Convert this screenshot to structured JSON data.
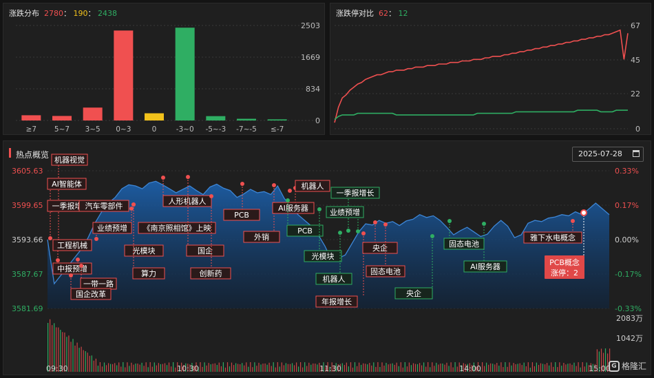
{
  "dist_panel": {
    "title": "涨跌分布",
    "up": "2780",
    "sep1": "：",
    "flat": "190",
    "sep2": "：",
    "down": "2438"
  },
  "limit_panel": {
    "title": "涨跌停对比",
    "up": "62",
    "sep": "：",
    "down": "12"
  },
  "hot_panel": {
    "title": "热点概览",
    "date": "2025-07-28"
  },
  "logo": {
    "icon": "G",
    "text": "格隆汇"
  },
  "colors": {
    "red": "#f05050",
    "green": "#2fae63",
    "yellow": "#f2c21b",
    "blue": "#1d5fa8"
  },
  "chart_data": [
    {
      "type": "bar",
      "categories": [
        "≥7",
        "5~7",
        "3~5",
        "0~3",
        "0",
        "-3~0",
        "-5~-3",
        "-7~-5",
        "≤-7"
      ],
      "values": [
        138,
        120,
        340,
        2370,
        190,
        2445,
        115,
        45,
        30
      ],
      "yticks": [
        "2503",
        "1669",
        "834",
        "0"
      ],
      "ylim": [
        0,
        2503
      ],
      "colors": [
        "#f05050",
        "#f05050",
        "#f05050",
        "#f05050",
        "#f2c21b",
        "#2fae63",
        "#2fae63",
        "#2fae63",
        "#2fae63"
      ]
    },
    {
      "type": "line",
      "yticks": [
        "67",
        "45",
        "22",
        "0"
      ],
      "ylim": [
        0,
        67
      ],
      "series": [
        {
          "color": "#f05050",
          "values": [
            4,
            14,
            20,
            22,
            25,
            27,
            29,
            30,
            32,
            33,
            34,
            35,
            35,
            36,
            37,
            37,
            38,
            38,
            38,
            39,
            39,
            40,
            40,
            40,
            41,
            41,
            41,
            42,
            42,
            42,
            43,
            43,
            43,
            44,
            44,
            44,
            45,
            45,
            45,
            46,
            46,
            47,
            47,
            47,
            48,
            48,
            49,
            49,
            50,
            50,
            51,
            51,
            52,
            52,
            53,
            53,
            54,
            54,
            55,
            55,
            56,
            56,
            57,
            57,
            58,
            58,
            59,
            59,
            60,
            60,
            61,
            61,
            62,
            63,
            64,
            45,
            62
          ]
        },
        {
          "color": "#2fae63",
          "values": [
            6,
            8,
            9,
            9,
            9,
            9,
            10,
            10,
            10,
            10,
            10,
            10,
            10,
            10,
            10,
            10,
            9,
            9,
            9,
            9,
            9,
            9,
            9,
            9,
            9,
            9,
            9,
            9,
            9,
            9,
            9,
            9,
            9,
            9,
            9,
            9,
            9,
            10,
            10,
            10,
            10,
            10,
            10,
            10,
            10,
            10,
            10,
            11,
            11,
            11,
            11,
            11,
            11,
            11,
            11,
            11,
            11,
            11,
            11,
            11,
            11,
            11,
            11,
            12,
            12,
            12,
            12,
            12,
            12,
            11,
            11,
            11,
            11,
            12,
            12,
            12,
            12
          ]
        }
      ]
    },
    {
      "type": "area",
      "y_left_ticks": [
        "3605.63",
        "3599.65",
        "3593.66",
        "3587.67",
        "3581.69"
      ],
      "y_right_ticks": [
        "0.33%",
        "0.17%",
        "0.00%",
        "-0.17%",
        "-0.33%"
      ],
      "ylim": [
        3581.69,
        3605.63
      ],
      "vol_ticks": [
        "2083万",
        "1042万"
      ],
      "x_ticks": [
        "09:30",
        "10:30",
        "11:30",
        "14:00",
        "15:00"
      ],
      "price": [
        3593.66,
        3586.0,
        3587.5,
        3589.0,
        3590.5,
        3592.0,
        3594.0,
        3596.5,
        3598.5,
        3600.0,
        3601.0,
        3602.5,
        3603.2,
        3603.0,
        3602.5,
        3603.5,
        3603.8,
        3603.2,
        3602.5,
        3601.8,
        3602.4,
        3603.0,
        3602.2,
        3601.5,
        3602.8,
        3603.3,
        3602.6,
        3602.2,
        3601.0,
        3601.6,
        3602.4,
        3601.8,
        3602.0,
        3601.5,
        3603.0,
        3600.8,
        3599.5,
        3598.0,
        3597.0,
        3596.0,
        3594.5,
        3592.5,
        3590.0,
        3590.4,
        3591.0,
        3593.0,
        3595.0,
        3596.4,
        3596.2,
        3597.0,
        3596.5,
        3596.8,
        3596.1,
        3596.9,
        3597.2,
        3598.0,
        3597.5,
        3597.8,
        3597.0,
        3595.8,
        3594.5,
        3595.2,
        3595.8,
        3595.0,
        3594.2,
        3594.6,
        3596.0,
        3597.0,
        3596.0,
        3594.0,
        3594.5,
        3596.5,
        3597.0,
        3596.8,
        3597.4,
        3597.6,
        3598.0,
        3597.8,
        3598.5,
        3598.0,
        3599.0,
        3600.0,
        3599.0,
        3598.0
      ],
      "annotations": [
        {
          "label": "机器视觉",
          "color": "red",
          "at": 0.2
        },
        {
          "label": "AI智能体",
          "color": "red",
          "at": 0.2
        },
        {
          "label": "一季报增长",
          "color": "red",
          "at": 0.2
        },
        {
          "label": "汽车零部件",
          "color": "red",
          "at": 0.5
        },
        {
          "label": "业绩预增",
          "color": "red",
          "at": 1.0
        },
        {
          "label": "工程机械",
          "color": "red",
          "at": 1.0
        },
        {
          "label": "中报预增",
          "color": "red",
          "at": 2.0
        },
        {
          "label": "一带一路",
          "color": "red",
          "at": 2.0
        },
        {
          "label": "国企改革",
          "color": "red",
          "at": 2.0
        },
        {
          "label": "《南京照相馆》上映",
          "color": "red",
          "at": 3.0
        },
        {
          "label": "光模块",
          "color": "red",
          "at": 3.0
        },
        {
          "label": "算力",
          "color": "red",
          "at": 4.0
        },
        {
          "label": "人形机器人",
          "color": "red",
          "at": 5.0
        },
        {
          "label": "国企",
          "color": "red",
          "at": 5.0
        },
        {
          "label": "创新药",
          "color": "red",
          "at": 6.0
        },
        {
          "label": "PCB",
          "color": "red",
          "at": 7.0
        },
        {
          "label": "外销",
          "color": "red",
          "at": 8.0
        },
        {
          "label": "AI服务器",
          "color": "red",
          "at": 9.0
        },
        {
          "label": "机器人",
          "color": "red",
          "at": 10.0
        },
        {
          "label": "PCB",
          "color": "green",
          "at": 10.0
        },
        {
          "label": "光模块",
          "color": "green",
          "at": 11.0
        },
        {
          "label": "机器人",
          "color": "green",
          "at": 11.0
        },
        {
          "label": "一季报增长",
          "color": "green",
          "at": 12.0
        },
        {
          "label": "业绩预增",
          "color": "green",
          "at": 12.0
        },
        {
          "label": "年报增长",
          "color": "red",
          "at": 13.0
        },
        {
          "label": "央企",
          "color": "red",
          "at": 14.0
        },
        {
          "label": "固态电池",
          "color": "red",
          "at": 14.0
        },
        {
          "label": "央企",
          "color": "green",
          "at": 15.0
        },
        {
          "label": "固态电池",
          "color": "green",
          "at": 16.0
        },
        {
          "label": "AI服务器",
          "color": "green",
          "at": 17.0
        },
        {
          "label": "雅下水电概念",
          "color": "red",
          "at": 18.0
        }
      ],
      "highlight": {
        "label1": "PCB概念",
        "label2": "涨停：2"
      }
    }
  ]
}
